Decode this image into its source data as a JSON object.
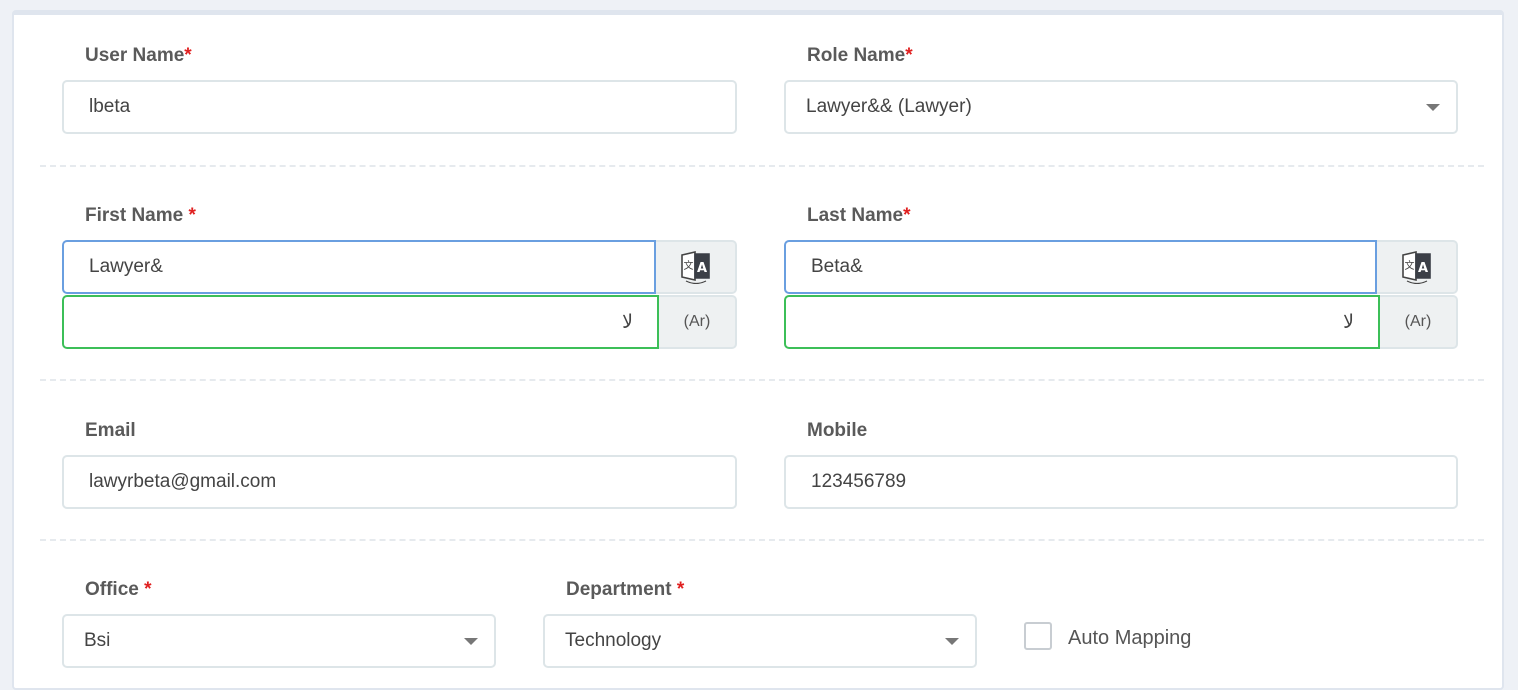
{
  "user_name": {
    "label": "User Name",
    "required": "*",
    "value": "lbeta"
  },
  "role_name": {
    "label": "Role Name",
    "required": "*",
    "value": "Lawyer&& (Lawyer)"
  },
  "first_name": {
    "label": "First Name",
    "required": "*",
    "value": "Lawyer&",
    "arabic_value": "لا",
    "arabic_addon": "(Ar)"
  },
  "last_name": {
    "label": "Last Name",
    "required": "*",
    "value": "Beta&",
    "arabic_value": "لا",
    "arabic_addon": "(Ar)"
  },
  "email": {
    "label": "Email",
    "value": "lawyrbeta@gmail.com"
  },
  "mobile": {
    "label": "Mobile",
    "value": "123456789"
  },
  "office": {
    "label": "Office",
    "required": "*",
    "value": "Bsi"
  },
  "department": {
    "label": "Department",
    "required": "*",
    "value": "Technology"
  },
  "auto_mapping": {
    "label": "Auto Mapping",
    "checked": false
  },
  "icons": {
    "translate": "translate-icon",
    "dropdown": "chevron-down-icon"
  },
  "colors": {
    "required": "#e02020",
    "focus_border": "#6a9fe0",
    "arabic_border": "#3cbf58"
  }
}
